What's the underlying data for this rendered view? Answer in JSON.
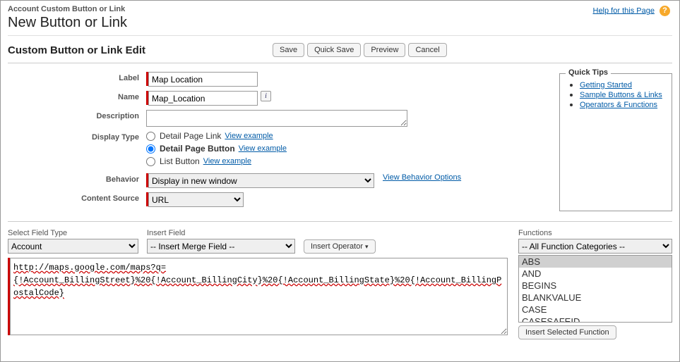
{
  "breadcrumb": "Account Custom Button or Link",
  "page_title": "New Button or Link",
  "help_link": "Help for this Page",
  "section_title": "Custom Button or Link Edit",
  "buttons": {
    "save": "Save",
    "quick_save": "Quick Save",
    "preview": "Preview",
    "cancel": "Cancel"
  },
  "labels": {
    "label": "Label",
    "name": "Name",
    "description": "Description",
    "display_type": "Display Type",
    "behavior": "Behavior",
    "content_source": "Content Source",
    "select_field_type": "Select Field Type",
    "insert_field": "Insert Field",
    "functions": "Functions"
  },
  "values": {
    "label": "Map Location",
    "name": "Map_Location",
    "description": "",
    "editor": "http://maps.google.com/maps?q={!Account_BillingStreet}%20{!Account_BillingCity}%20{!Account_BillingState}%20{!Account_BillingPostalCode}"
  },
  "display_type": {
    "options": [
      {
        "label": "Detail Page Link",
        "checked": false
      },
      {
        "label": "Detail Page Button",
        "checked": true
      },
      {
        "label": "List Button",
        "checked": false
      }
    ],
    "view_example": "View example"
  },
  "behavior": {
    "selected": "Display in new window",
    "link": "View Behavior Options"
  },
  "content_source": {
    "selected": "URL"
  },
  "quick_tips": {
    "title": "Quick Tips",
    "items": [
      "Getting Started",
      "Sample Buttons & Links",
      "Operators & Functions"
    ]
  },
  "select_field_type": {
    "selected": "Account"
  },
  "insert_merge_field": {
    "placeholder": "-- Insert Merge Field --"
  },
  "insert_operator": "Insert Operator",
  "functions": {
    "category": "-- All Function Categories --",
    "list": [
      "ABS",
      "AND",
      "BEGINS",
      "BLANKVALUE",
      "CASE",
      "CASESAFEID"
    ],
    "selected": "ABS",
    "insert_btn": "Insert Selected Function"
  }
}
